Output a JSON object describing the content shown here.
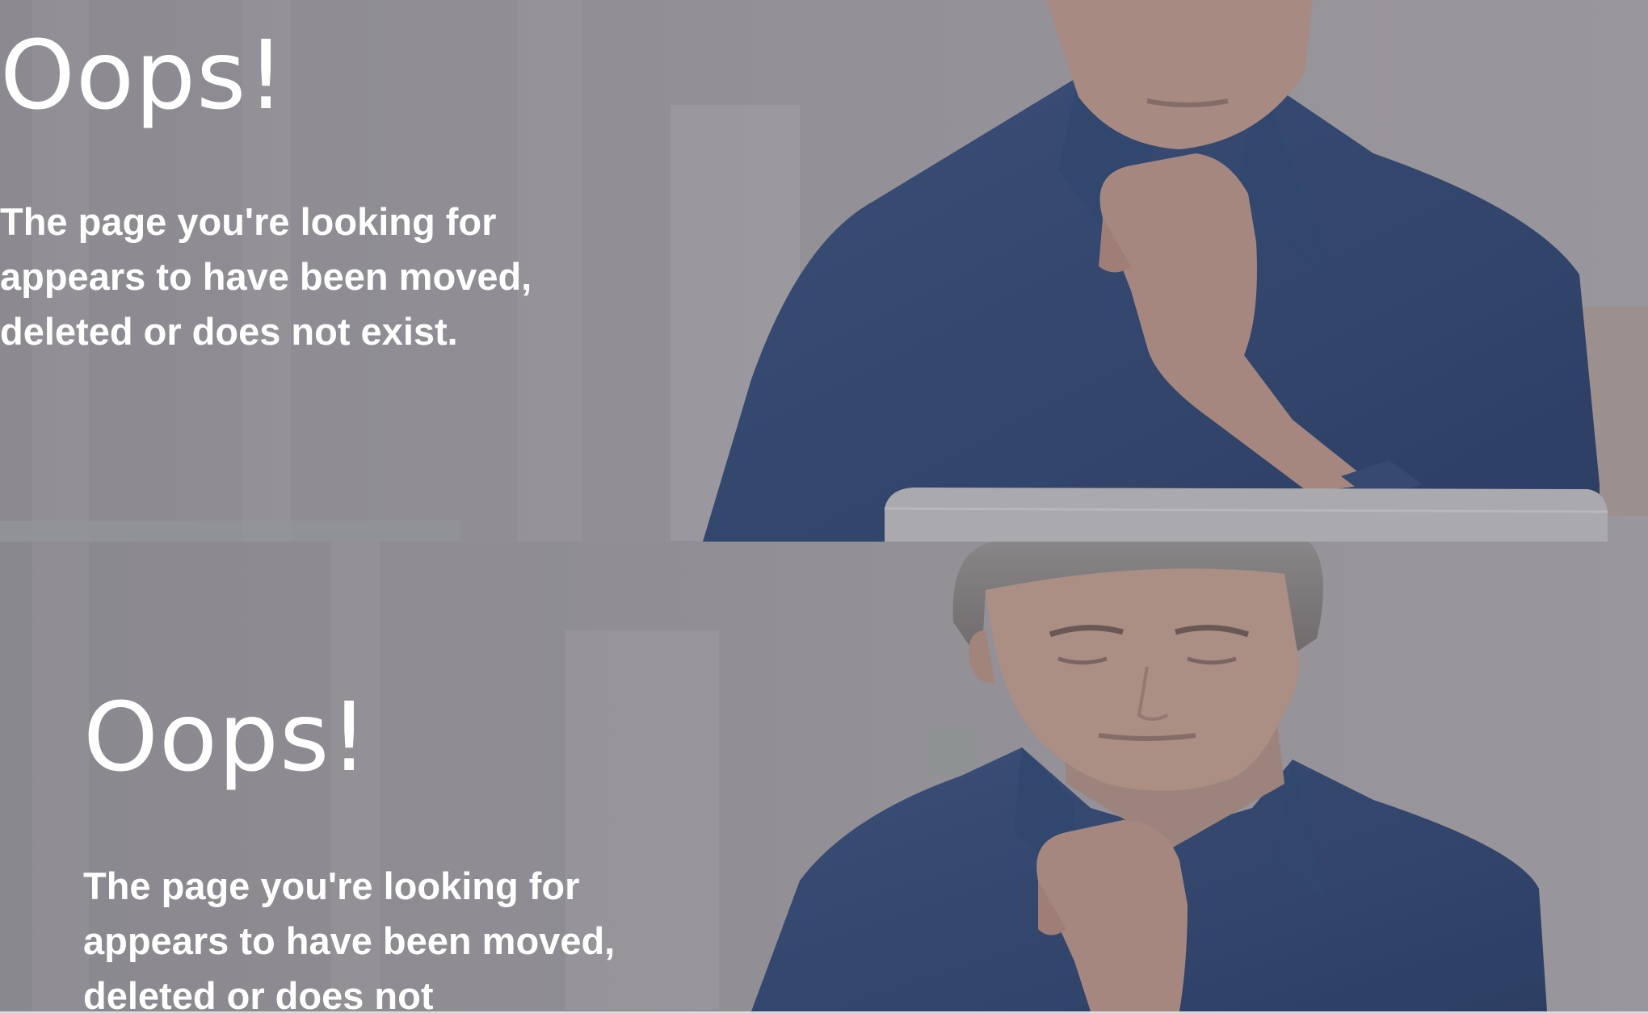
{
  "top_panel": {
    "headline": "Oops!",
    "message": "The page you're looking for appears to have been moved, deleted or does not exist."
  },
  "bottom_panel": {
    "headline": "Oops!",
    "message": "The page you're looking for appears to have been moved, deleted or does not"
  },
  "colors": {
    "overlay": "#8f8d92",
    "shirt": "#2b4470",
    "text": "#ffffff"
  }
}
